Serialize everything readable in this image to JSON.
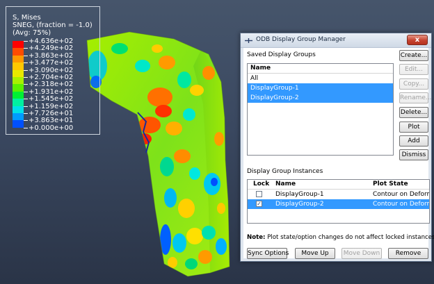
{
  "legend": {
    "title_lines": [
      "S, Mises",
      "SNEG, (fraction = -1.0)",
      "(Avg: 75%)"
    ],
    "values": [
      "+4.636e+02",
      "+4.249e+02",
      "+3.863e+02",
      "+3.477e+02",
      "+3.090e+02",
      "+2.704e+02",
      "+2.318e+02",
      "+1.931e+02",
      "+1.545e+02",
      "+1.159e+02",
      "+7.726e+01",
      "+3.863e+01",
      "+0.000e+00"
    ],
    "colors": [
      "#ff0000",
      "#ff4c00",
      "#ff9900",
      "#ffc800",
      "#e8e800",
      "#a8f000",
      "#5cf000",
      "#00f034",
      "#00f0a0",
      "#00e0e8",
      "#009cff",
      "#0050ff",
      "#0000ff"
    ]
  },
  "dialog": {
    "title": "ODB Display Group Manager",
    "close_label": "x",
    "saved_groups_label": "Saved Display Groups",
    "saved_list": {
      "header": "Name",
      "items": [
        {
          "name": "All",
          "selected": false
        },
        {
          "name": "DisplayGroup-1",
          "selected": true
        },
        {
          "name": "DisplayGroup-2",
          "selected": true
        }
      ]
    },
    "side_buttons": {
      "create": "Create...",
      "edit": "Edit...",
      "copy": "Copy...",
      "rename": "Rename...",
      "delete": "Delete...",
      "plot": "Plot",
      "add": "Add",
      "dismiss": "Dismiss"
    },
    "instances_label": "Display Group Instances",
    "instances_table": {
      "headers": {
        "lock": "Lock",
        "name": "Name",
        "plot_state": "Plot State"
      },
      "rows": [
        {
          "locked": false,
          "name": "DisplayGroup-1",
          "plot_state": "Contour on Deformed",
          "selected": false
        },
        {
          "locked": true,
          "name": "DisplayGroup-2",
          "plot_state": "Contour on Deformed",
          "selected": true
        }
      ]
    },
    "note_label": "Note:",
    "note_text": "Plot state/option changes do not affect locked instances.",
    "bottom_buttons": {
      "sync": "Sync Options",
      "move_up": "Move Up",
      "move_down": "Move Down",
      "remove": "Remove"
    }
  }
}
